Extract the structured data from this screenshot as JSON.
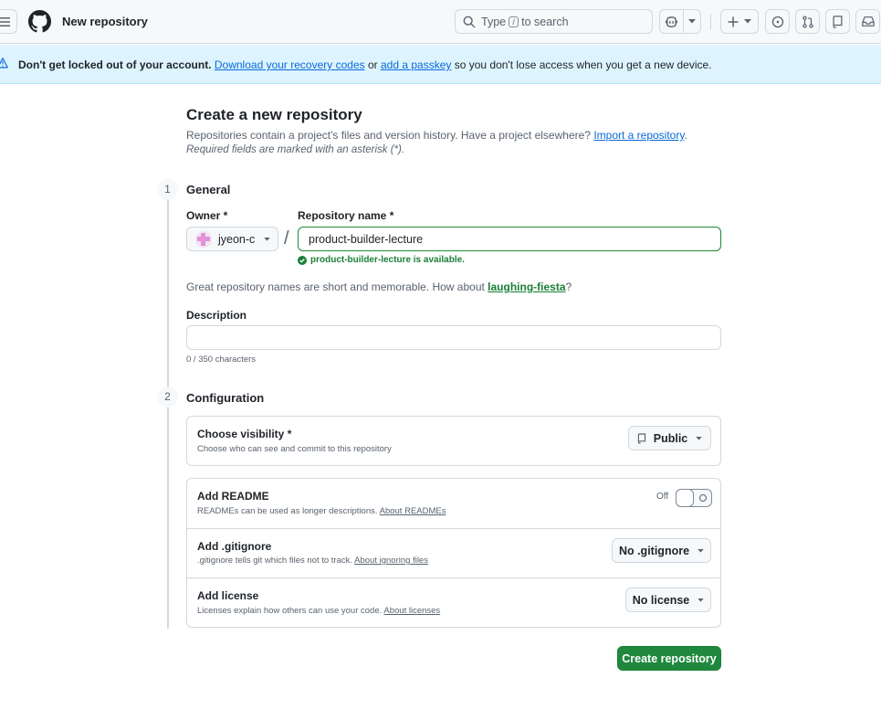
{
  "header": {
    "page_name": "New repository",
    "search_prefix": "Type",
    "search_key": "/",
    "search_suffix": "to search"
  },
  "banner": {
    "lead": "Don't get locked out of your account.",
    "link1": "Download your recovery codes",
    "mid": "or",
    "link2": "add a passkey",
    "tail": "so you don't lose access when you get a new device."
  },
  "page": {
    "title": "Create a new repository",
    "subtitle_text": "Repositories contain a project's files and version history. Have a project elsewhere?",
    "import_link": "Import a repository",
    "subtitle_end": ".",
    "required_note": "Required fields are marked with an asterisk (*)."
  },
  "general": {
    "step": "1",
    "title": "General",
    "owner_label": "Owner *",
    "owner_value": "jyeon-c",
    "slash": "/",
    "repo_label": "Repository name *",
    "repo_value": "product-builder-lecture",
    "available_msg": "product-builder-lecture is available.",
    "suggest_text": "Great repository names are short and memorable. How about",
    "suggest_name": "laughing-fiesta",
    "suggest_end": "?",
    "description_label": "Description",
    "description_value": "",
    "counter": "0 / 350 characters"
  },
  "configuration": {
    "step": "2",
    "title": "Configuration",
    "visibility": {
      "title": "Choose visibility *",
      "desc": "Choose who can see and commit to this repository",
      "value": "Public"
    },
    "readme": {
      "title": "Add README",
      "desc": "READMEs can be used as longer descriptions.",
      "link": "About READMEs",
      "toggle_label": "Off"
    },
    "gitignore": {
      "title": "Add .gitignore",
      "desc": ".gitignore tells git which files not to track.",
      "link": "About ignoring files",
      "value": "No .gitignore"
    },
    "license": {
      "title": "Add license",
      "desc": "Licenses explain how others can use your code.",
      "link": "About licenses",
      "value": "No license"
    }
  },
  "actions": {
    "create_label": "Create repository"
  },
  "colors": {
    "accent_link": "#0969da",
    "success": "#1a7f37",
    "primary_button": "#1f883d",
    "banner_bg": "#ddf4ff"
  }
}
